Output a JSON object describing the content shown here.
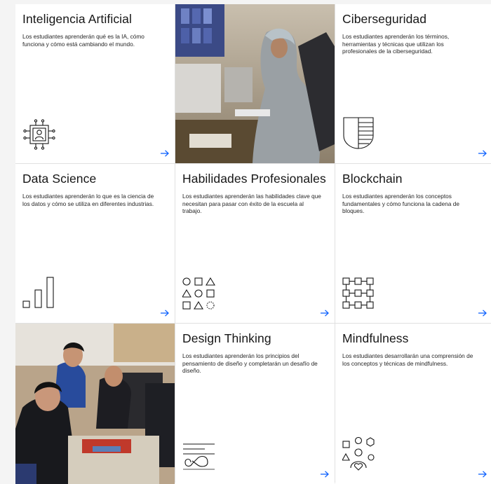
{
  "tiles": [
    {
      "title": "Inteligencia Artificial",
      "text": "Los estudiantes aprenderán qué es la IA, cómo funciona y cómo está cambiando el mundo.",
      "icon": "ai-chip-icon"
    },
    {
      "photo": "students-computer-lab-photo"
    },
    {
      "title": "Ciberseguridad",
      "text": "Los estudiantes aprenderán los términos, herramientas y técnicas que utilizan los profesionales de la ciberseguridad.",
      "icon": "shield-icon"
    },
    {
      "title": "Data Science",
      "text": "Los estudiantes aprenderán lo que es la ciencia de los datos y cómo se utiliza en diferentes industrias.",
      "icon": "bar-chart-icon"
    },
    {
      "title": "Habilidades Profesionales",
      "text": "Los estudiantes aprenderán las habilidades clave que necesitan para pasar con éxito de la escuela al trabajo.",
      "icon": "shapes-grid-icon"
    },
    {
      "title": "Blockchain",
      "text": "Los estudiantes aprenderán los conceptos fundamentales y cómo funciona la cadena de bloques.",
      "icon": "blockchain-icon"
    },
    {
      "photo": "students-robotics-photo"
    },
    {
      "title": "Design Thinking",
      "text": "Los estudiantes aprenderán los principios del pensamiento de diseño y completarán un desafío de diseño.",
      "icon": "infinity-loop-icon"
    },
    {
      "title": "Mindfulness",
      "text": "Los estudiantes desarrollarán una comprensión de los conceptos y técnicas de mindfulness.",
      "icon": "mindfulness-icon"
    }
  ],
  "colors": {
    "accent": "#0f62fe",
    "text": "#161616",
    "border": "#e0e0e0",
    "page": "#f4f4f4"
  }
}
